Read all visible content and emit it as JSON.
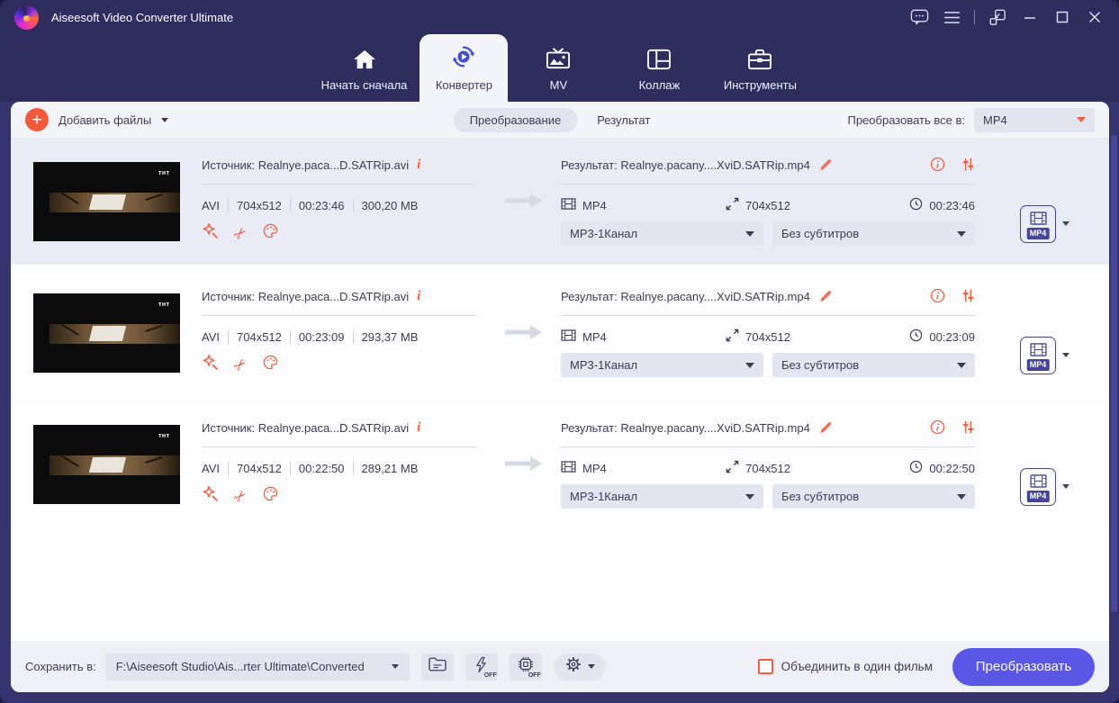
{
  "colors": {
    "header": "#2f2d5e",
    "frame": "#36336e",
    "accent_orange": "#f0603f",
    "accent_indigo": "#5a57e6",
    "row_selected": "#e9ebf5"
  },
  "icons": {
    "feedback-icon": "speech-bubble-dots",
    "menu-icon": "hamburger",
    "mini-mode-icon": "shrink-window",
    "minimize-icon": "line",
    "maximize-icon": "square",
    "close-icon": "cross",
    "add-icon": "plus-circle",
    "edit-effects-icon": "magic-wand",
    "cut-icon": "scissors",
    "color-icon": "palette",
    "rename-icon": "pencil",
    "info-icon": "italic-i",
    "media-info-icon": "circled-i",
    "adjust-icon": "vertical-sliders",
    "format-icon": "film-strip",
    "resolution-icon": "expand-arrows",
    "duration-icon": "clock",
    "open-folder-icon": "folder",
    "hw-accel-icon": "lightning-bolt",
    "gpu-icon": "chip",
    "settings-icon": "gear"
  },
  "titlebar": {
    "app_title": "Aiseesoft Video Converter Ultimate"
  },
  "nav": {
    "tabs": [
      {
        "label": "Начать сначала"
      },
      {
        "label": "Конвертер"
      },
      {
        "label": "MV"
      },
      {
        "label": "Коллаж"
      },
      {
        "label": "Инструменты"
      }
    ]
  },
  "toolbar": {
    "add_files_label": "Добавить файлы",
    "view_tabs": [
      {
        "label": "Преобразование"
      },
      {
        "label": "Результат"
      }
    ],
    "convert_all_label": "Преобразовать все в:",
    "convert_all_value": "MP4"
  },
  "thumb_logo": "тнт",
  "files": [
    {
      "source_label": "Источник: Realnye.paca...D.SATRip.avi",
      "format": "AVI",
      "resolution": "704x512",
      "duration": "00:23:46",
      "size": "300,20 MB",
      "result_label": "Результат: Realnye.pacany....XviD.SATRip.mp4",
      "out_format": "MP4",
      "out_resolution": "704x512",
      "out_duration": "00:23:46",
      "audio_option": "MP3-1Канал",
      "subtitle_option": "Без субтитров",
      "output_badge": "MP4"
    },
    {
      "source_label": "Источник: Realnye.paca...D.SATRip.avi",
      "format": "AVI",
      "resolution": "704x512",
      "duration": "00:23:09",
      "size": "293,37 MB",
      "result_label": "Результат: Realnye.pacany....XviD.SATRip.mp4",
      "out_format": "MP4",
      "out_resolution": "704x512",
      "out_duration": "00:23:09",
      "audio_option": "MP3-1Канал",
      "subtitle_option": "Без субтитров",
      "output_badge": "MP4"
    },
    {
      "source_label": "Источник: Realnye.paca...D.SATRip.avi",
      "format": "AVI",
      "resolution": "704x512",
      "duration": "00:22:50",
      "size": "289,21 MB",
      "result_label": "Результат: Realnye.pacany....XviD.SATRip.mp4",
      "out_format": "MP4",
      "out_resolution": "704x512",
      "out_duration": "00:22:50",
      "audio_option": "MP3-1Канал",
      "subtitle_option": "Без субтитров",
      "output_badge": "MP4"
    }
  ],
  "footer": {
    "save_to_label": "Сохранить в:",
    "save_path": "F:\\Aiseesoft Studio\\Ais...rter Ultimate\\Converted",
    "hw_accel_off": "OFF",
    "gpu_off": "OFF",
    "merge_label": "Объединить в один фильм",
    "convert_button_label": "Преобразовать"
  }
}
